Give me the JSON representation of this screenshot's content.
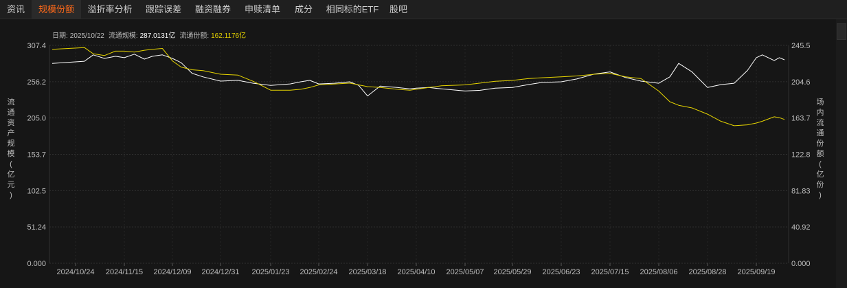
{
  "tabs": [
    {
      "label": "资讯",
      "active": false
    },
    {
      "label": "规模份额",
      "active": true
    },
    {
      "label": "溢折率分析",
      "active": false
    },
    {
      "label": "跟踪误差",
      "active": false
    },
    {
      "label": "融资融券",
      "active": false
    },
    {
      "label": "申赎清单",
      "active": false
    },
    {
      "label": "成分",
      "active": false
    },
    {
      "label": "相同标的ETF",
      "active": false
    },
    {
      "label": "股吧",
      "active": false
    }
  ],
  "info": {
    "date_label": "日期:",
    "date_value": "2025/10/22",
    "scale_label": "流通规模:",
    "scale_value": "287.0131亿",
    "share_label": "流通份额:",
    "share_value": "162.1176亿"
  },
  "colors": {
    "background": "#161616",
    "grid": "#2e2e2e",
    "scale_line": "#ffffff",
    "share_line": "#e6d400",
    "active_tab": "#ff6a1a"
  },
  "chart_data": {
    "type": "line",
    "grid": true,
    "x_ticks": [
      "2024/10/24",
      "2024/11/15",
      "2024/12/09",
      "2024/12/31",
      "2025/01/23",
      "2025/02/24",
      "2025/03/18",
      "2025/04/10",
      "2025/05/07",
      "2025/05/29",
      "2025/06/23",
      "2025/07/15",
      "2025/08/06",
      "2025/08/28",
      "2025/09/19"
    ],
    "y_left": {
      "label": "流通资产规模（亿元）",
      "ticks": [
        "307.4",
        "256.2",
        "205.0",
        "153.7",
        "102.5",
        "51.24",
        "0.000"
      ],
      "range": [
        0,
        307.4
      ]
    },
    "y_right": {
      "label": "场内流通份额（亿份）",
      "ticks": [
        "245.5",
        "204.6",
        "163.7",
        "122.8",
        "81.83",
        "40.92",
        "0.000"
      ],
      "range": [
        0,
        245.5
      ]
    },
    "series": [
      {
        "name": "流通规模",
        "axis": "left",
        "color": "#ffffff",
        "x": [
          "2024/10/22",
          "2024/10/28",
          "2024/11/01",
          "2024/11/06",
          "2024/11/11",
          "2024/11/15",
          "2024/11/20",
          "2024/11/25",
          "2024/11/29",
          "2024/12/04",
          "2024/12/09",
          "2024/12/13",
          "2024/12/18",
          "2024/12/23",
          "2024/12/31",
          "2025/01/08",
          "2025/01/15",
          "2025/01/23",
          "2025/02/05",
          "2025/02/12",
          "2025/02/18",
          "2025/02/24",
          "2025/03/03",
          "2025/03/10",
          "2025/03/14",
          "2025/03/18",
          "2025/03/24",
          "2025/04/01",
          "2025/04/07",
          "2025/04/10",
          "2025/04/17",
          "2025/04/24",
          "2025/05/07",
          "2025/05/14",
          "2025/05/21",
          "2025/05/29",
          "2025/06/06",
          "2025/06/13",
          "2025/06/23",
          "2025/06/30",
          "2025/07/08",
          "2025/07/15",
          "2025/07/22",
          "2025/07/29",
          "2025/08/06",
          "2025/08/11",
          "2025/08/15",
          "2025/08/21",
          "2025/08/28",
          "2025/09/03",
          "2025/09/09",
          "2025/09/15",
          "2025/09/19",
          "2025/09/26",
          "2025/10/10",
          "2025/10/16",
          "2025/10/22"
        ],
        "values": [
          282,
          285,
          294,
          289,
          292,
          290,
          295,
          288,
          292,
          294,
          289,
          283,
          268,
          263,
          257,
          258,
          254,
          251,
          253,
          256,
          258,
          253,
          254,
          256,
          251,
          236,
          250,
          248,
          246,
          247,
          248,
          246,
          243,
          244,
          247,
          248,
          252,
          255,
          256,
          260,
          267,
          270,
          262,
          257,
          254,
          263,
          282,
          270,
          248,
          252,
          254,
          272,
          290,
          294,
          286,
          290,
          287
        ]
      },
      {
        "name": "流通份额",
        "axis": "right",
        "color": "#e6d400",
        "x": [
          "2024/10/22",
          "2024/10/28",
          "2024/11/01",
          "2024/11/06",
          "2024/11/11",
          "2024/11/15",
          "2024/11/20",
          "2024/11/25",
          "2024/11/29",
          "2024/12/04",
          "2024/12/09",
          "2024/12/13",
          "2024/12/18",
          "2024/12/23",
          "2024/12/31",
          "2025/01/08",
          "2025/01/15",
          "2025/01/23",
          "2025/02/05",
          "2025/02/12",
          "2025/02/18",
          "2025/02/24",
          "2025/03/03",
          "2025/03/10",
          "2025/03/14",
          "2025/03/18",
          "2025/03/24",
          "2025/04/01",
          "2025/04/07",
          "2025/04/10",
          "2025/04/17",
          "2025/04/24",
          "2025/05/07",
          "2025/05/14",
          "2025/05/21",
          "2025/05/29",
          "2025/06/06",
          "2025/06/13",
          "2025/06/23",
          "2025/06/30",
          "2025/07/08",
          "2025/07/15",
          "2025/07/22",
          "2025/07/29",
          "2025/08/06",
          "2025/08/11",
          "2025/08/15",
          "2025/08/21",
          "2025/08/28",
          "2025/09/03",
          "2025/09/09",
          "2025/09/15",
          "2025/09/19",
          "2025/09/26",
          "2025/10/10",
          "2025/10/16",
          "2025/10/22"
        ],
        "values": [
          241,
          243,
          236,
          234,
          239,
          239,
          238,
          240,
          241,
          242,
          228,
          221,
          218,
          217,
          213,
          212,
          205,
          195,
          195,
          196,
          198,
          201,
          202,
          203,
          201,
          199,
          198,
          196,
          195,
          196,
          198,
          200,
          201,
          203,
          205,
          206,
          208,
          209,
          210,
          211,
          213,
          214,
          210,
          208,
          194,
          182,
          178,
          175,
          168,
          160,
          155,
          156,
          158,
          160,
          165,
          164,
          162
        ]
      }
    ]
  }
}
